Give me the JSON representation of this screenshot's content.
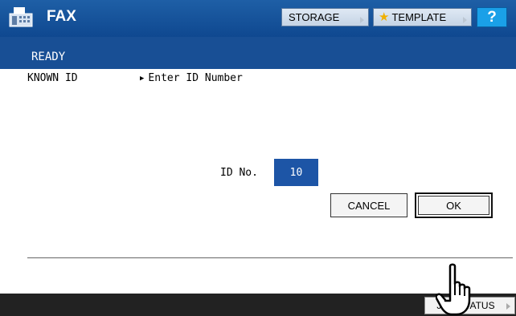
{
  "header": {
    "title": "FAX",
    "storage_label": "STORAGE",
    "template_label": "TEMPLATE",
    "help_label": "?"
  },
  "status": {
    "text": "READY"
  },
  "main": {
    "mode_label": "KNOWN ID",
    "instruction": "Enter ID Number",
    "id_label": "ID No.",
    "id_value": "10"
  },
  "buttons": {
    "cancel": "CANCEL",
    "ok": "OK"
  },
  "footer": {
    "job_status_label": "JOB STATUS"
  },
  "icons": {
    "fax": "fax-icon",
    "template": "star-icon",
    "cursor": "hand-pointer-icon"
  },
  "colors": {
    "header_blue": "#1e5fa6",
    "status_blue": "#184f95",
    "id_box": "#1d55a6",
    "help": "#1aa0e8",
    "footer": "#222222"
  }
}
